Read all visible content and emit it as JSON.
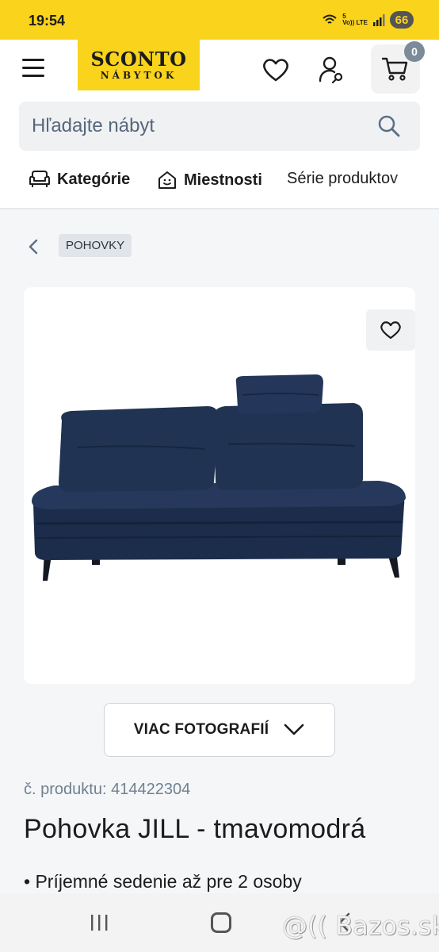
{
  "status_bar": {
    "time": "19:54",
    "network_top": "5",
    "network_label": "Vo)) LTE",
    "battery": "66"
  },
  "header": {
    "logo_main": "SCONTO",
    "logo_sub": "NÁBYTOK",
    "cart_count": "0"
  },
  "search": {
    "placeholder": "Hľadajte nábyt"
  },
  "nav": {
    "items": [
      {
        "label": "Kategórie",
        "icon": "armchair-icon"
      },
      {
        "label": "Miestnosti",
        "icon": "smiley-house-icon"
      },
      {
        "label": "Série produktov"
      }
    ]
  },
  "breadcrumb": {
    "label": "POHOVKY"
  },
  "product": {
    "more_photos_label": "VIAC FOTOGRAFIÍ",
    "number_label": "č. produktu:",
    "number_value": "414422304",
    "title": "Pohovka JILL - tmavomodrá",
    "bullet": "• Príjemné sedenie až pre 2 osoby",
    "image_description": "dark blue velvet sofa bed with cushions"
  },
  "watermark": "@(( Bazos.sk",
  "colors": {
    "brand_yellow": "#f9d31c",
    "sofa_blue": "#1d2f4f",
    "badge_grey": "#7c8b99"
  }
}
